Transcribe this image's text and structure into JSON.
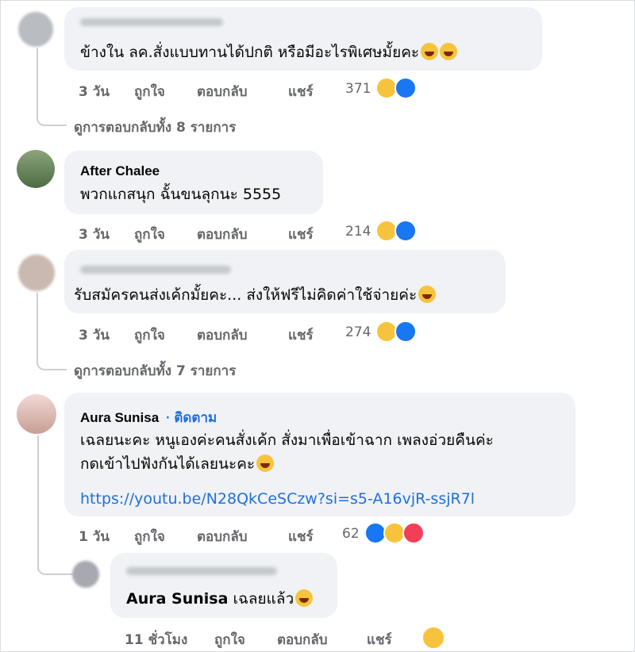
{
  "comments": [
    {
      "text": "ข้างใน ลค.สั่งแบบทานได้ปกติ หรือมีอะไรพิเศษมั้ยคะ",
      "time": "3 วัน",
      "like": "ถูกใจ",
      "reply": "ตอบกลับ",
      "share": "แชร์",
      "count": "371",
      "view_replies": "ดูการตอบกลับทั้ง 8 รายการ"
    },
    {
      "name": "After Chalee",
      "text": "พวกแกสนุก ฉั้นขนลุกนะ 5555",
      "time": "3 วัน",
      "like": "ถูกใจ",
      "reply": "ตอบกลับ",
      "share": "แชร์",
      "count": "214"
    },
    {
      "text": "รับสมัครคนส่งเค้กมั้ยคะ... ส่งให้ฟรีไม่คิดค่าใช้จ่ายค่ะ",
      "time": "3 วัน",
      "like": "ถูกใจ",
      "reply": "ตอบกลับ",
      "share": "แชร์",
      "count": "274",
      "view_replies": "ดูการตอบกลับทั้ง 7 รายการ"
    },
    {
      "name": "Aura Sunisa",
      "follow": "· ติดตาม",
      "text_line1": "เฉลยนะคะ หนูเองค่ะคนสั่งเค้ก สั่งมาเพื่อเข้าฉาก เพลงอ่วยคืนค่ะ",
      "text_line2": "กดเข้าไปฟังกันได้เลยนะคะ",
      "link": "https://youtu.be/N28QkCeSCzw?si=s5-A16vjR-ssjR7l",
      "time": "1 วัน",
      "like": "ถูกใจ",
      "reply": "ตอบกลับ",
      "share": "แชร์",
      "count": "62"
    },
    {
      "mention": "Aura Sunisa",
      "text": " เฉลยแล้ว",
      "time": "11 ชั่วโมง",
      "like": "ถูกใจ",
      "reply": "ตอบกลับ",
      "share": "แชร์"
    }
  ],
  "colors": {
    "link": "#216fdb",
    "meta": "#65676b",
    "bubble": "#f0f2f5",
    "like": "#1877f2",
    "haha": "#f8c33c",
    "love": "#f33e58"
  },
  "icons": [
    "haha-emoji-icon",
    "like-reaction-icon",
    "love-reaction-icon"
  ]
}
